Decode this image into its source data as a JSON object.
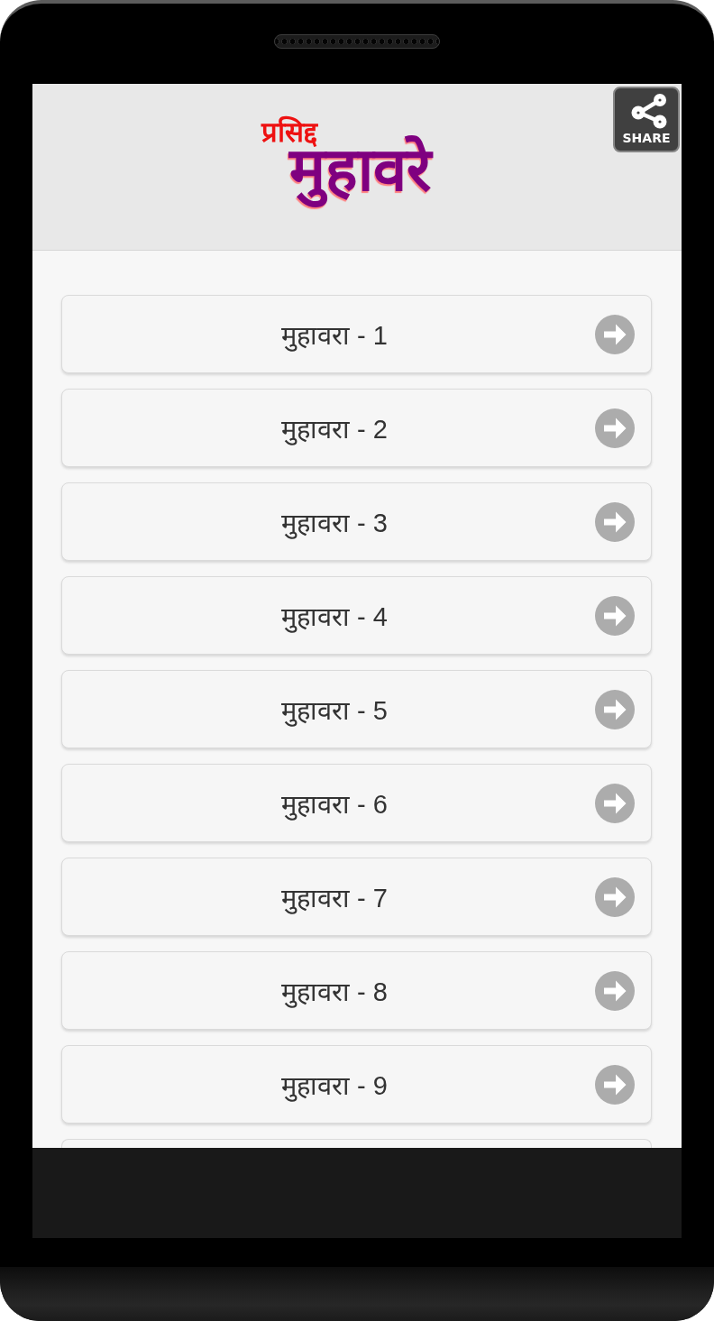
{
  "header": {
    "logo": {
      "subtitle": "प्रसिद्द",
      "title": "मुहावरे"
    },
    "share_button": {
      "label": "SHARE"
    }
  },
  "list": {
    "items": [
      {
        "label": "मुहावरा - 1"
      },
      {
        "label": "मुहावरा - 2"
      },
      {
        "label": "मुहावरा - 3"
      },
      {
        "label": "मुहावरा - 4"
      },
      {
        "label": "मुहावरा - 5"
      },
      {
        "label": "मुहावरा - 6"
      },
      {
        "label": "मुहावरा - 7"
      },
      {
        "label": "मुहावरा - 8"
      },
      {
        "label": "मुहावरा - 9"
      }
    ],
    "more_below": true
  }
}
